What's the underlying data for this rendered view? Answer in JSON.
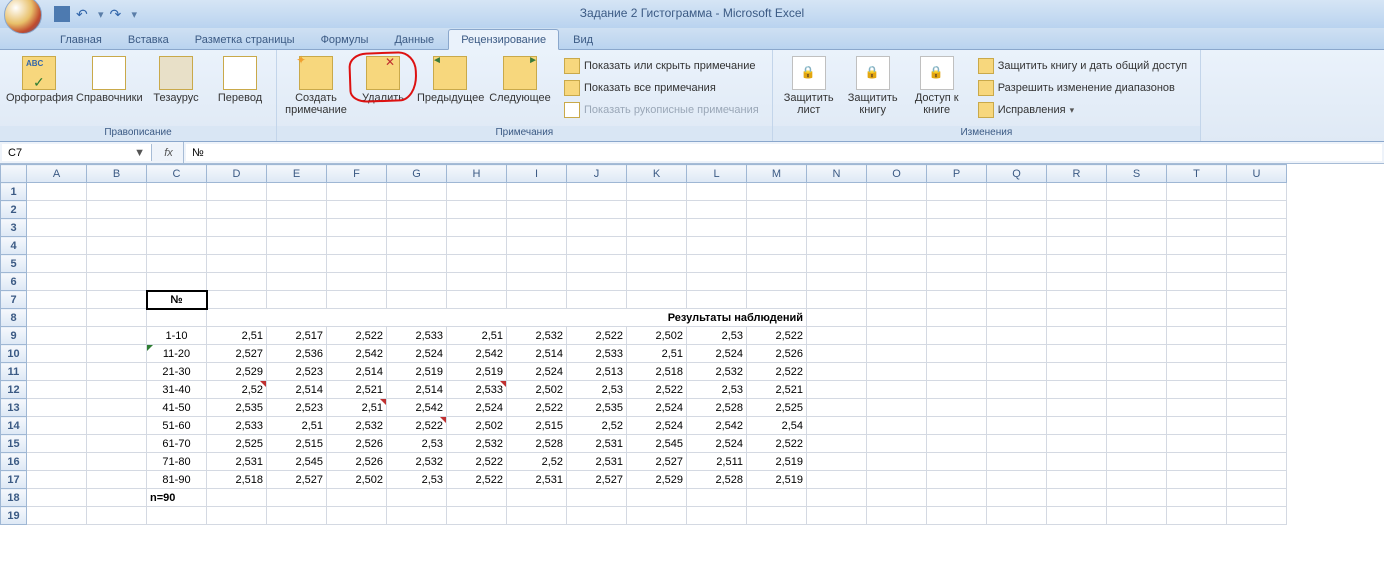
{
  "title": "Задание 2 Гистограмма - Microsoft Excel",
  "tabs": [
    "Главная",
    "Вставка",
    "Разметка страницы",
    "Формулы",
    "Данные",
    "Рецензирование",
    "Вид"
  ],
  "activeTab": 5,
  "ribbon": {
    "g1": {
      "label": "Правописание",
      "btns": [
        {
          "label": "Орфография"
        },
        {
          "label": "Справочники"
        },
        {
          "label": "Тезаурус"
        },
        {
          "label": "Перевод"
        }
      ]
    },
    "g2": {
      "label": "Примечания",
      "big": [
        {
          "label": "Создать примечание"
        },
        {
          "label": "Удалить"
        },
        {
          "label": "Предыдущее"
        },
        {
          "label": "Следующее"
        }
      ],
      "small": [
        {
          "label": "Показать или скрыть примечание"
        },
        {
          "label": "Показать все примечания"
        },
        {
          "label": "Показать рукописные примечания"
        }
      ]
    },
    "g3": {
      "label": "Изменения",
      "big": [
        {
          "label": "Защитить лист"
        },
        {
          "label": "Защитить книгу"
        },
        {
          "label": "Доступ к книге"
        }
      ],
      "small": [
        {
          "label": "Защитить книгу и дать общий доступ"
        },
        {
          "label": "Разрешить изменение диапазонов"
        },
        {
          "label": "Исправления"
        }
      ]
    }
  },
  "namebox": "C7",
  "formula": "№",
  "columns": [
    "A",
    "B",
    "C",
    "D",
    "E",
    "F",
    "G",
    "H",
    "I",
    "J",
    "K",
    "L",
    "M",
    "N",
    "O",
    "P",
    "Q",
    "R",
    "S",
    "T",
    "U"
  ],
  "titleRow": {
    "no": "№",
    "merged": "Результаты наблюдений"
  },
  "nlabel": "n=90",
  "rows": [
    {
      "r": "1-10",
      "v": [
        "2,51",
        "2,517",
        "2,522",
        "2,533",
        "2,51",
        "2,532",
        "2,522",
        "2,502",
        "2,53",
        "2,522"
      ]
    },
    {
      "r": "11-20",
      "v": [
        "2,527",
        "2,536",
        "2,542",
        "2,524",
        "2,542",
        "2,514",
        "2,533",
        "2,51",
        "2,524",
        "2,526"
      ]
    },
    {
      "r": "21-30",
      "v": [
        "2,529",
        "2,523",
        "2,514",
        "2,519",
        "2,519",
        "2,524",
        "2,513",
        "2,518",
        "2,532",
        "2,522"
      ]
    },
    {
      "r": "31-40",
      "v": [
        "2,52",
        "2,514",
        "2,521",
        "2,514",
        "2,533",
        "2,502",
        "2,53",
        "2,522",
        "2,53",
        "2,521"
      ]
    },
    {
      "r": "41-50",
      "v": [
        "2,535",
        "2,523",
        "2,51",
        "2,542",
        "2,524",
        "2,522",
        "2,535",
        "2,524",
        "2,528",
        "2,525"
      ]
    },
    {
      "r": "51-60",
      "v": [
        "2,533",
        "2,51",
        "2,532",
        "2,522",
        "2,502",
        "2,515",
        "2,52",
        "2,524",
        "2,542",
        "2,54"
      ]
    },
    {
      "r": "61-70",
      "v": [
        "2,525",
        "2,515",
        "2,526",
        "2,53",
        "2,532",
        "2,528",
        "2,531",
        "2,545",
        "2,524",
        "2,522"
      ]
    },
    {
      "r": "71-80",
      "v": [
        "2,531",
        "2,545",
        "2,526",
        "2,532",
        "2,522",
        "2,52",
        "2,531",
        "2,527",
        "2,511",
        "2,519"
      ]
    },
    {
      "r": "81-90",
      "v": [
        "2,518",
        "2,527",
        "2,502",
        "2,53",
        "2,522",
        "2,531",
        "2,527",
        "2,529",
        "2,528",
        "2,519"
      ]
    }
  ],
  "chart_data": {
    "type": "table",
    "title": "Результаты наблюдений",
    "categories": [
      "1-10",
      "11-20",
      "21-30",
      "31-40",
      "41-50",
      "51-60",
      "61-70",
      "71-80",
      "81-90"
    ],
    "series": [
      {
        "name": "1-10",
        "values": [
          2.51,
          2.517,
          2.522,
          2.533,
          2.51,
          2.532,
          2.522,
          2.502,
          2.53,
          2.522
        ]
      },
      {
        "name": "11-20",
        "values": [
          2.527,
          2.536,
          2.542,
          2.524,
          2.542,
          2.514,
          2.533,
          2.51,
          2.524,
          2.526
        ]
      },
      {
        "name": "21-30",
        "values": [
          2.529,
          2.523,
          2.514,
          2.519,
          2.519,
          2.524,
          2.513,
          2.518,
          2.532,
          2.522
        ]
      },
      {
        "name": "31-40",
        "values": [
          2.52,
          2.514,
          2.521,
          2.514,
          2.533,
          2.502,
          2.53,
          2.522,
          2.53,
          2.521
        ]
      },
      {
        "name": "41-50",
        "values": [
          2.535,
          2.523,
          2.51,
          2.542,
          2.524,
          2.522,
          2.535,
          2.524,
          2.528,
          2.525
        ]
      },
      {
        "name": "51-60",
        "values": [
          2.533,
          2.51,
          2.532,
          2.522,
          2.502,
          2.515,
          2.52,
          2.524,
          2.542,
          2.54
        ]
      },
      {
        "name": "61-70",
        "values": [
          2.525,
          2.515,
          2.526,
          2.53,
          2.532,
          2.528,
          2.531,
          2.545,
          2.524,
          2.522
        ]
      },
      {
        "name": "71-80",
        "values": [
          2.531,
          2.545,
          2.526,
          2.532,
          2.522,
          2.52,
          2.531,
          2.527,
          2.511,
          2.519
        ]
      },
      {
        "name": "81-90",
        "values": [
          2.518,
          2.527,
          2.502,
          2.53,
          2.522,
          2.531,
          2.527,
          2.529,
          2.528,
          2.519
        ]
      }
    ],
    "n": 90
  }
}
